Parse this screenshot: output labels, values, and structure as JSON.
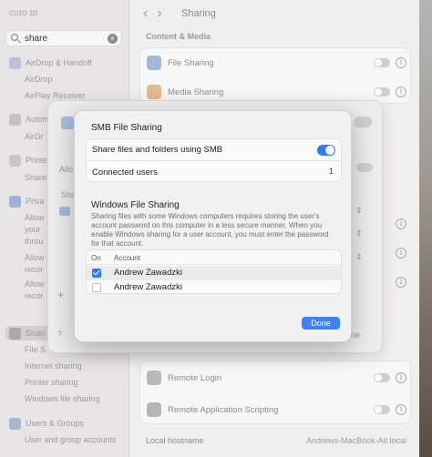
{
  "sidebar": {
    "title": "ᴄᴜɪᴏ ɪɒ",
    "search_value": "share",
    "items": [
      {
        "label": "AirDrop & Handoff",
        "kind": "group"
      },
      {
        "label": "AirDrop",
        "kind": "sub"
      },
      {
        "label": "AirPlay Receiver",
        "kind": "sub"
      },
      {
        "label": "Autom",
        "kind": "group"
      },
      {
        "label": "AirDr",
        "kind": "sub"
      },
      {
        "label": "Printe",
        "kind": "group"
      },
      {
        "label": "Share",
        "kind": "sub"
      },
      {
        "label": "Priva",
        "kind": "group"
      },
      {
        "label": "Allow",
        "kind": "sub"
      },
      {
        "label": "your",
        "kind": "sub"
      },
      {
        "label": "throu",
        "kind": "sub"
      },
      {
        "label": "Allow",
        "kind": "sub"
      },
      {
        "label": "recor",
        "kind": "sub"
      },
      {
        "label": "Allow",
        "kind": "sub"
      },
      {
        "label": "recor",
        "kind": "sub"
      },
      {
        "label": "Shari",
        "kind": "selected"
      },
      {
        "label": "File S",
        "kind": "sub"
      },
      {
        "label": "Internet sharing",
        "kind": "sub"
      },
      {
        "label": "Printer sharing",
        "kind": "sub"
      },
      {
        "label": "Windows file sharing",
        "kind": "sub"
      },
      {
        "label": "Users & Groups",
        "kind": "group"
      },
      {
        "label": "User and group accounts",
        "kind": "sub"
      }
    ]
  },
  "main": {
    "title": "Sharing",
    "section": "Content & Media",
    "rows": [
      {
        "label": "File Sharing"
      },
      {
        "label": "Media Sharing"
      },
      {
        "label": "Remote Login"
      },
      {
        "label": "Remote Application Scripting"
      }
    ],
    "hostname_label": "Local hostname",
    "hostname_value": "Andrews-MacBook-Air.local"
  },
  "sheet2": {
    "allo": "Allo",
    "sha": "Sha",
    "plus": "+",
    "question": "?",
    "ne": "ne"
  },
  "dialog": {
    "title": "SMB File Sharing",
    "share_label": "Share files and folders using SMB",
    "connected_label": "Connected users",
    "connected_count": "1",
    "windows_title": "Windows File Sharing",
    "windows_desc": "Sharing files with some Windows computers requires storing the user's account password on this computer in a less secure manner. When you enable Windows sharing for a user account, you must enter the password for that account.",
    "col_on": "On",
    "col_account": "Account",
    "accounts": [
      {
        "name": "Andrew Zawadzki",
        "on": true
      },
      {
        "name": "Andrew Zawadzki",
        "on": false
      }
    ],
    "done_label": "Done"
  },
  "colors": {
    "accent": "#2f7cf6",
    "done": "#3b82f6"
  }
}
